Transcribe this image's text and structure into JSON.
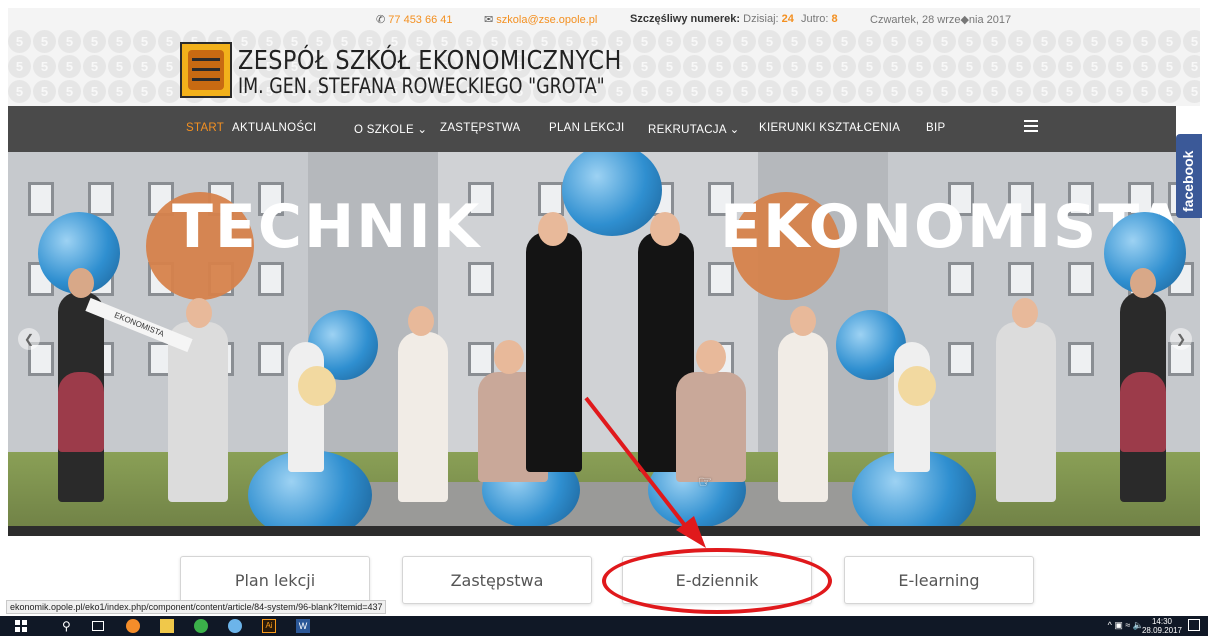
{
  "topbar": {
    "phone": "77 453 66 41",
    "email": "szkola@zse.opole.pl",
    "lucky_label": "Szczęśliwy numerek:",
    "today_label": "Dzisiaj:",
    "today_value": "24",
    "tomorrow_label": "Jutro:",
    "tomorrow_value": "8",
    "date": "Czwartek, 28 wrze◆nia 2017"
  },
  "logo": {
    "line1": "ZESPÓŁ SZKÓŁ EKONOMICZNYCH",
    "line2": "IM. GEN. STEFANA ROWECKIEGO \"GROTA\""
  },
  "nav": {
    "items": [
      {
        "label": "START",
        "active": true
      },
      {
        "label": "AKTUALNOŚCI"
      },
      {
        "label": "O SZKOLE ⌄"
      },
      {
        "label": "ZASTĘPSTWA"
      },
      {
        "label": "PLAN LEKCJI"
      },
      {
        "label": "REKRUTACJA ⌄"
      },
      {
        "label": "KIERUNKI KSZTAŁCENIA"
      },
      {
        "label": "BIP"
      }
    ]
  },
  "hero": {
    "word_left": "TECHNIK",
    "word_right": "EKONOMISTA",
    "banner_text": "EKONOMISTA"
  },
  "facebook": {
    "label": "facebook"
  },
  "quick_links": [
    {
      "label": "Plan lekcji"
    },
    {
      "label": "Zastępstwa"
    },
    {
      "label": "E-dziennik"
    },
    {
      "label": "E-learning"
    }
  ],
  "status_url": "ekonomik.opole.pl/eko1/index.php/component/content/article/84-system/96-blank?Itemid=437",
  "taskbar": {
    "time": "14:30",
    "date": "28.09.2017"
  },
  "colors": {
    "accent": "#f39021",
    "nav_bg": "#4a4a4a",
    "annotation_red": "#e0191c",
    "facebook_blue": "#3b5998"
  }
}
